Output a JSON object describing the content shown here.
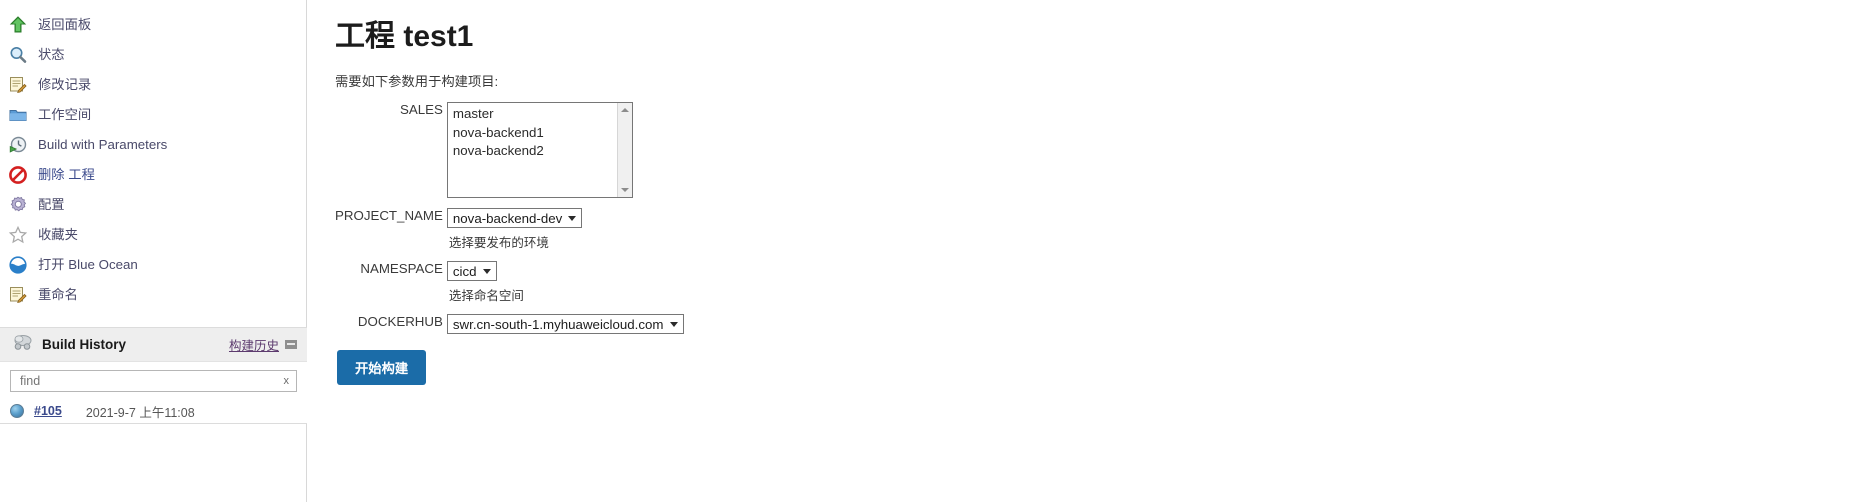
{
  "sidebar": {
    "nav_items": [
      {
        "label": "返回面板",
        "icon": "up-arrow-icon",
        "style": "plain"
      },
      {
        "label": "状态",
        "icon": "magnifier-icon",
        "style": "plain"
      },
      {
        "label": "修改记录",
        "icon": "notepad-pencil-icon",
        "style": "plain"
      },
      {
        "label": "工作空间",
        "icon": "folder-icon",
        "style": "plain"
      },
      {
        "label": "Build with Parameters",
        "icon": "clock-play-icon",
        "style": "plain"
      },
      {
        "label": "删除 工程",
        "icon": "no-entry-icon",
        "style": "blue"
      },
      {
        "label": "配置",
        "icon": "gear-icon",
        "style": "plain"
      },
      {
        "label": "收藏夹",
        "icon": "star-icon",
        "style": "plain"
      },
      {
        "label": "打开 Blue Ocean",
        "icon": "blue-ocean-icon",
        "style": "plain"
      },
      {
        "label": "重命名",
        "icon": "notepad-pencil-icon",
        "style": "plain"
      }
    ],
    "build_history": {
      "title": "Build History",
      "link_label": "构建历史",
      "rss_icon": "rss-icon",
      "find_placeholder": "find",
      "find_value": "",
      "find_clear_label": "x",
      "rows": [
        {
          "status_icon": "blue-ball-icon",
          "number": "#105",
          "date": "2021-9-7 上午11:08"
        }
      ]
    }
  },
  "main": {
    "title": "工程 test1",
    "description": "需要如下参数用于构建项目:",
    "parameters": [
      {
        "name": "SALES",
        "type": "listbox",
        "options": [
          "master",
          "nova-backend1",
          "nova-backend2"
        ],
        "description": ""
      },
      {
        "name": "PROJECT_NAME",
        "type": "select",
        "value": "nova-backend-dev",
        "description": "选择要发布的环境"
      },
      {
        "name": "NAMESPACE",
        "type": "select",
        "value": "cicd",
        "description": "选择命名空间"
      },
      {
        "name": "DOCKERHUB",
        "type": "select",
        "value": "swr.cn-south-1.myhuaweicloud.com",
        "description": ""
      }
    ],
    "build_button_label": "开始构建"
  },
  "colors": {
    "button_blue": "#1b6ca8",
    "link_purple": "#5c3a6e",
    "nav_text": "#4a4a6a",
    "panel_header_bg": "#eeeeee"
  }
}
